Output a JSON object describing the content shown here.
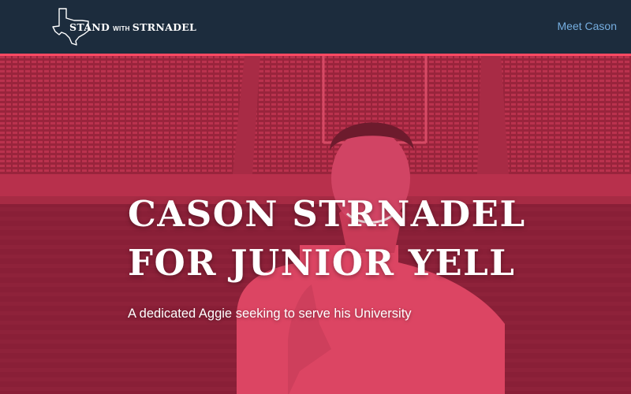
{
  "nav": {
    "logo": {
      "word1": "STAND",
      "word2": "WITH",
      "word3": "STRNADEL",
      "icon": "texas-outline-icon"
    },
    "links": [
      {
        "label": "Meet Cason"
      }
    ]
  },
  "hero": {
    "headline_line1": "CASON STRNADEL",
    "headline_line2": "FOR JUNIOR YELL",
    "tagline": "A dedicated Aggie seeking to serve his University",
    "overlay_color": "#c8344f",
    "accent_border": "#ff4a63"
  }
}
